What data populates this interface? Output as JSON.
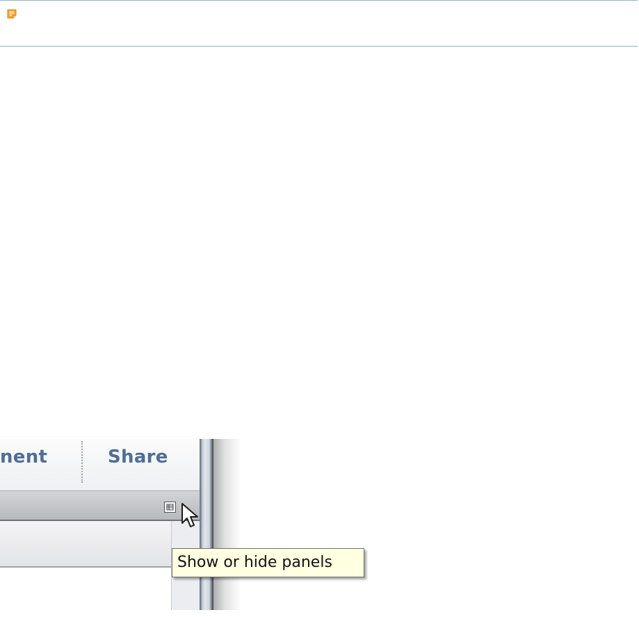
{
  "note": {
    "icon": "note-icon",
    "accent_color": "#f5a623",
    "border_color": "#8ab8bd"
  },
  "screenshot": {
    "tabs": [
      {
        "label": "nent"
      },
      {
        "label": "Share"
      }
    ],
    "panel_toggle_icon": "panels-toggle-icon",
    "cursor_icon": "mouse-pointer-icon",
    "tooltip": "Show or hide panels",
    "tab_text_color": "#4e6e96",
    "tooltip_background": "#ffffe2"
  }
}
